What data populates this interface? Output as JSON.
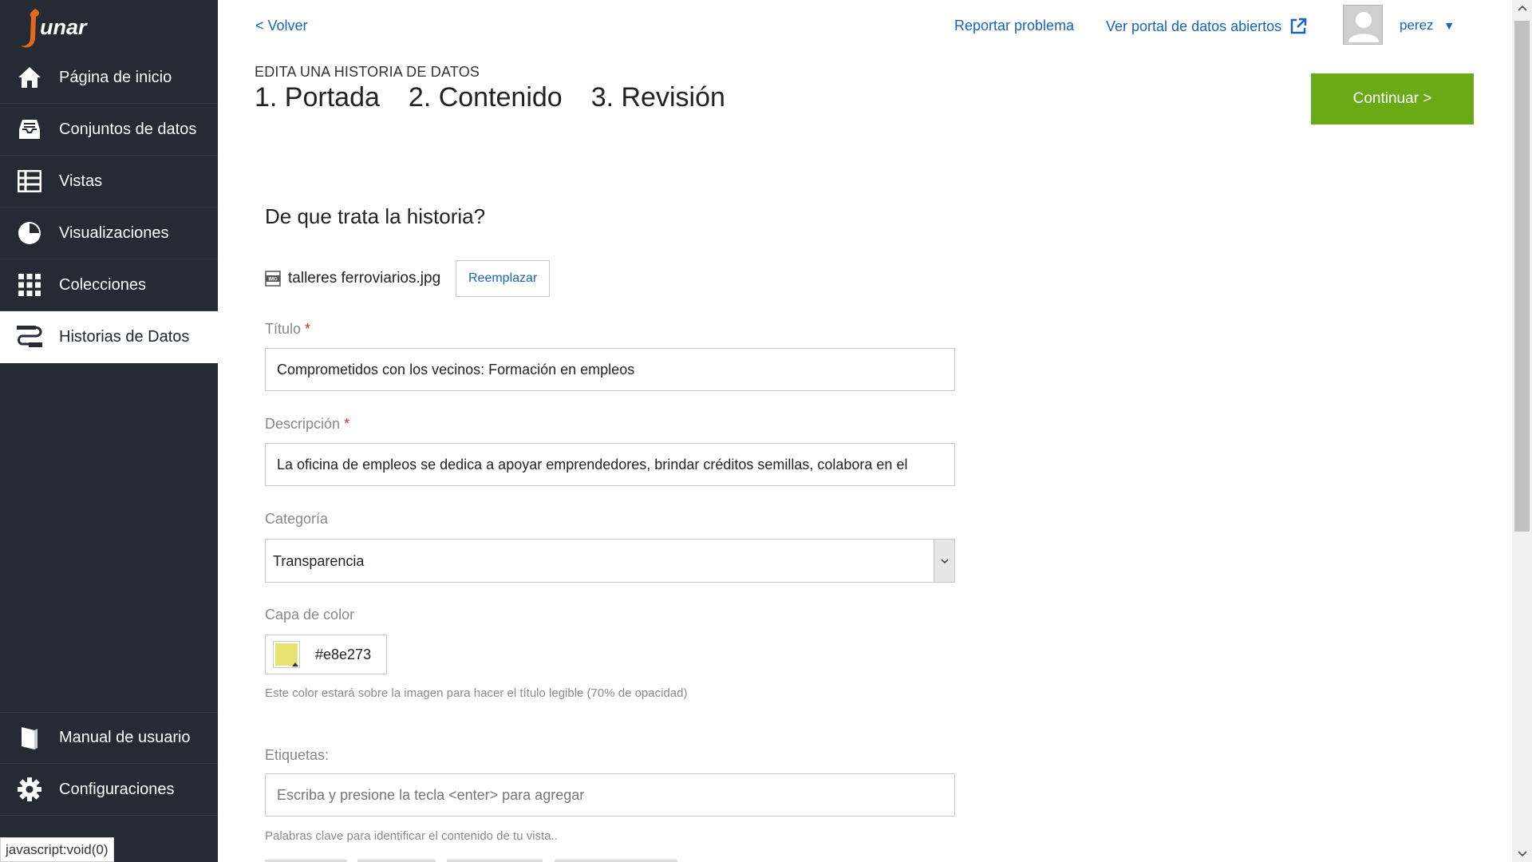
{
  "sidebar": {
    "logo_text": "junar",
    "items": [
      {
        "label": "Página de inicio",
        "icon": "home-icon"
      },
      {
        "label": "Conjuntos de datos",
        "icon": "inbox-icon"
      },
      {
        "label": "Vistas",
        "icon": "table-icon"
      },
      {
        "label": "Visualizaciones",
        "icon": "pie-chart-icon"
      },
      {
        "label": "Colecciones",
        "icon": "grid-icon"
      },
      {
        "label": "Historias de Datos",
        "icon": "story-icon",
        "active": true
      }
    ],
    "bottom_items": [
      {
        "label": "Manual de usuario",
        "icon": "book-icon"
      },
      {
        "label": "Configuraciones",
        "icon": "gear-icon"
      }
    ]
  },
  "status_bar": {
    "url": "javascript:void(0)"
  },
  "topbar": {
    "back": "< Volver",
    "report": "Reportar problema",
    "portal": "Ver portal de datos abiertos",
    "user": "perez"
  },
  "header": {
    "kicker": "EDITA UNA HISTORIA DE DATOS",
    "steps": [
      "1. Portada",
      "2. Contenido",
      "3. Revisión"
    ],
    "continue": "Continuar >"
  },
  "form": {
    "section_title": "De que trata la historia?",
    "file_name": "talleres ferroviarios.jpg",
    "replace": "Reemplazar",
    "title_label": "Título",
    "title_value": "Comprometidos con los vecinos: Formación en empleos",
    "description_label": "Descripción",
    "description_value": "La oficina de empleos se dedica a apoyar emprendedores, brindar créditos semillas, colabora en el",
    "required_mark": "*",
    "category_label": "Categoría",
    "category_value": "Transparencia",
    "color_label": "Capa de color",
    "color_value": "#e8e273",
    "color_help": "Este color estará sobre la imagen para hacer el título legible (70% de opacidad)",
    "tags_label": "Etiquetas:",
    "tags_placeholder": "Escriba y presione la tecla <enter> para agregar",
    "tags_help": "Palabras clave para identificar el contenido de tu vista.."
  },
  "colors": {
    "sidebar_bg": "#252a34",
    "accent_green": "#6aaa17",
    "link_blue": "#1565c0",
    "swatch": "#e8e273"
  }
}
